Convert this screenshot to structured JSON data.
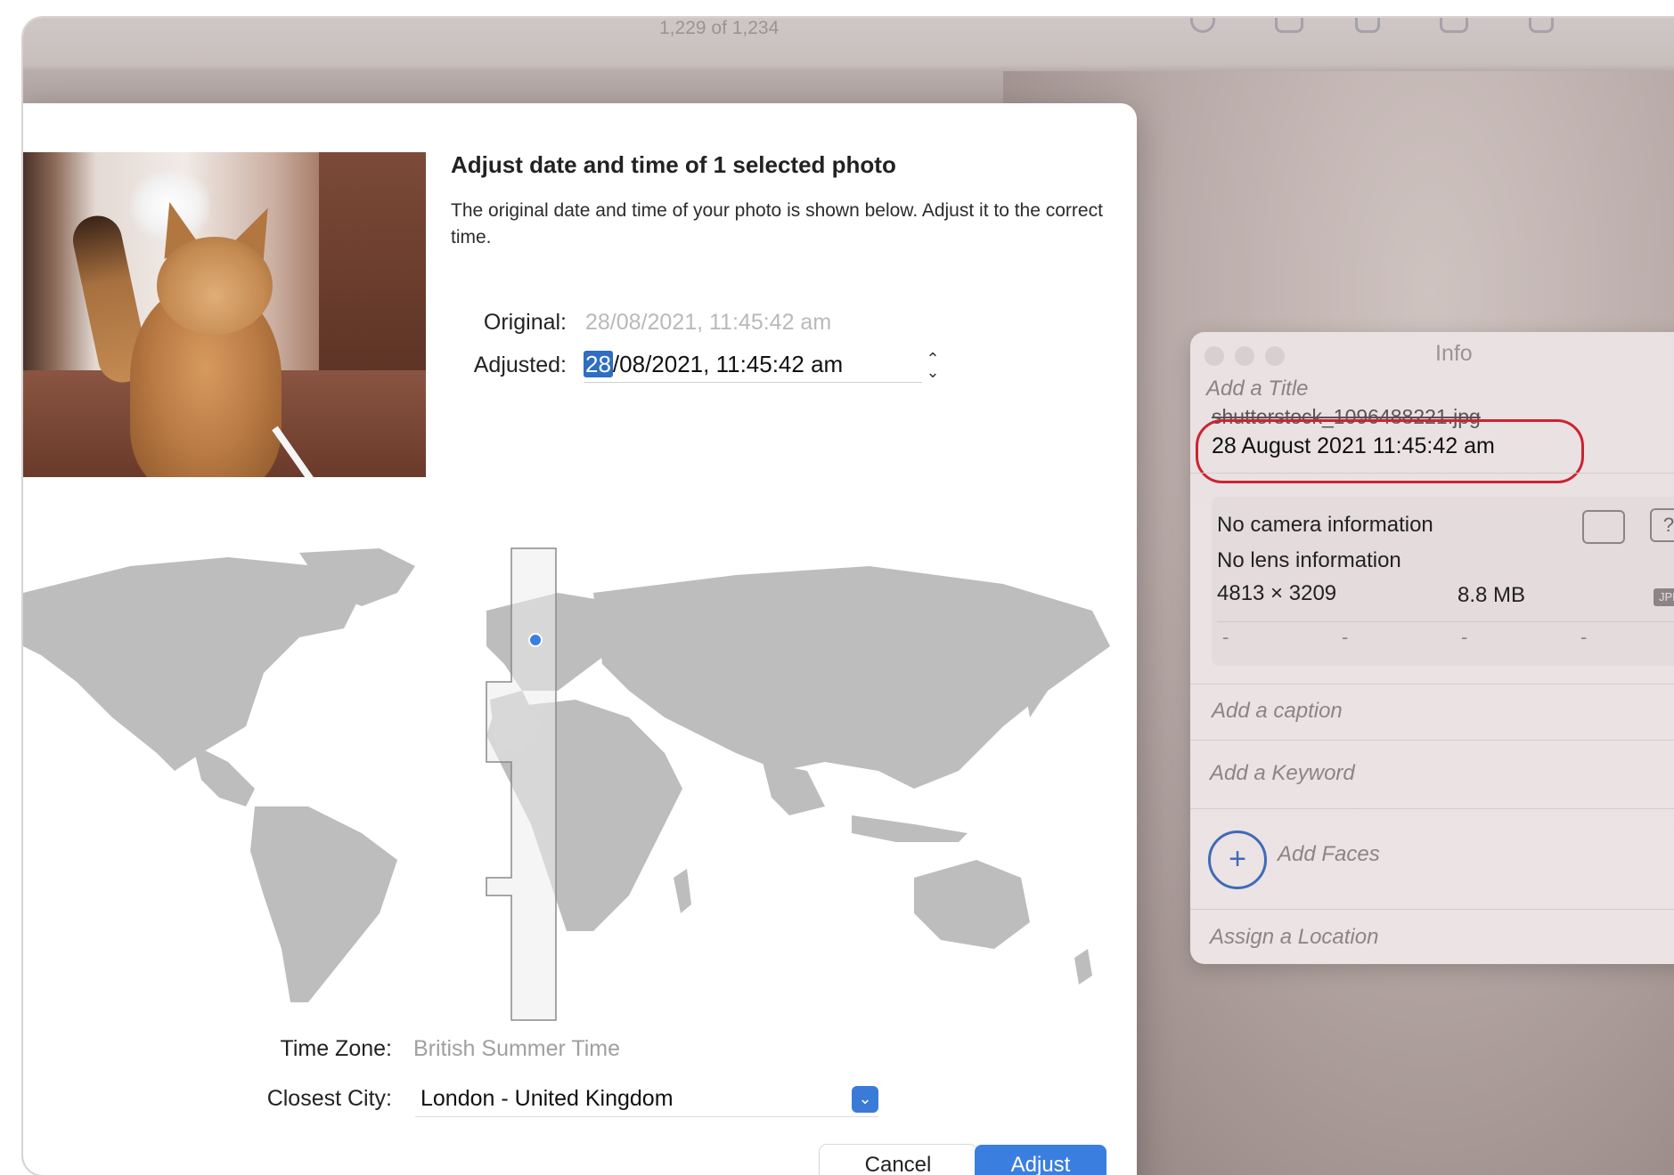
{
  "toolbar": {
    "counter": "1,229 of 1,234"
  },
  "dialog": {
    "title": "Adjust date and time of 1 selected photo",
    "description": "The original date and time of your photo is shown below. Adjust it to the correct time.",
    "original_label": "Original:",
    "original_value": "28/08/2021, 11:45:42 am",
    "adjusted_label": "Adjusted:",
    "adjusted_selected": "28",
    "adjusted_rest": "/08/2021, 11:45:42 am",
    "time_zone_label": "Time Zone:",
    "time_zone_value": "British Summer Time",
    "closest_city_label": "Closest City:",
    "closest_city_value": "London - United Kingdom",
    "cancel_label": "Cancel",
    "adjust_label": "Adjust"
  },
  "info": {
    "title": "Info",
    "add_title_placeholder": "Add a Title",
    "filename": "shutterstock_1096488221.jpg",
    "datetime": "28 August 2021   11:45:42 am",
    "camera": "No camera information",
    "lens": "No lens information",
    "dimensions": "4813 × 3209",
    "file_size": "8.8 MB",
    "format_badge": "JPEG",
    "exif_placeholders": [
      "-",
      "-",
      "-",
      "-",
      "-"
    ],
    "caption_placeholder": "Add a caption",
    "keyword_placeholder": "Add a Keyword",
    "faces_label": "Add Faces",
    "location_placeholder": "Assign a Location"
  },
  "colors": {
    "accent": "#3a7ee0",
    "highlight_oval": "#cc2330",
    "selection": "#2f6ec2"
  }
}
